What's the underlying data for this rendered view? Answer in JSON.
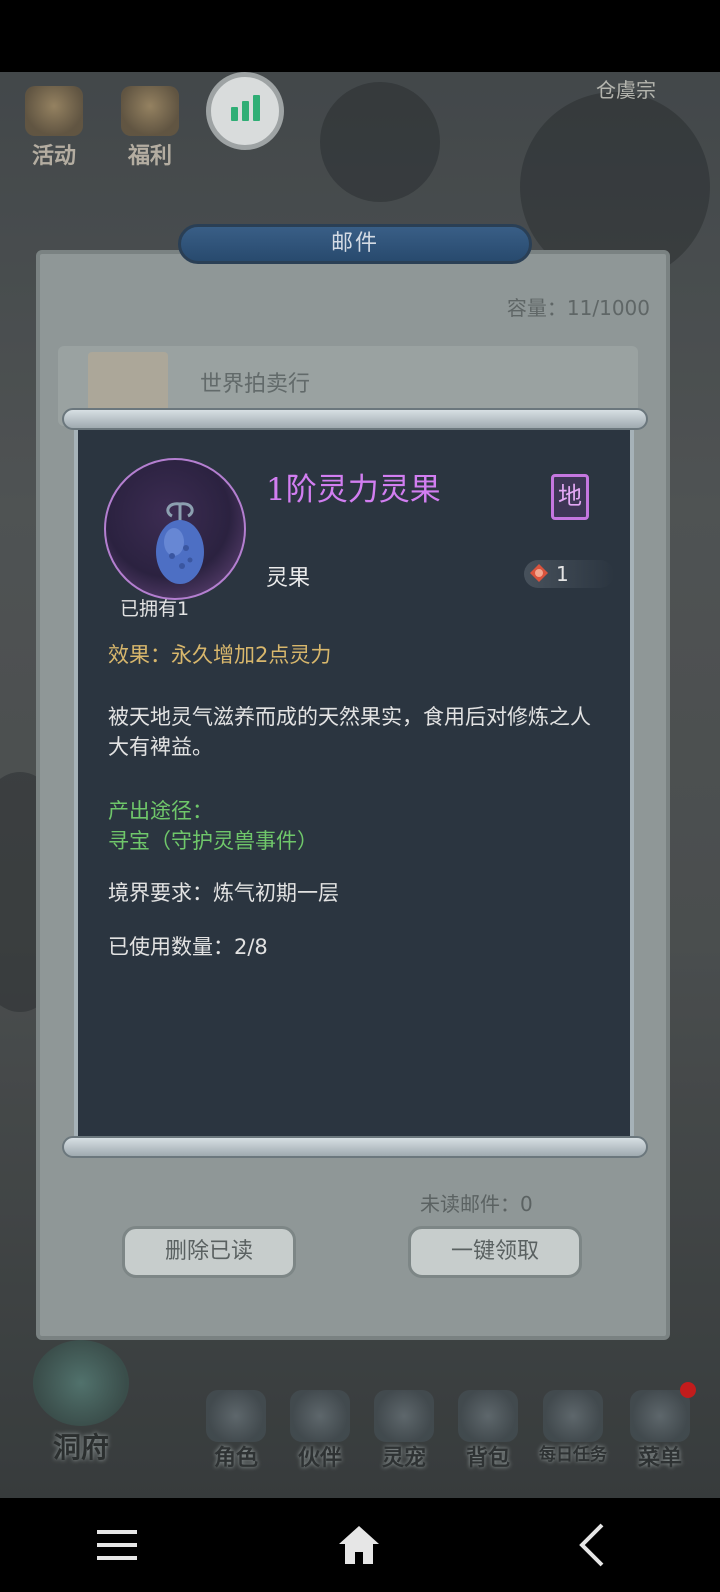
{
  "game": {
    "top_icons": [
      {
        "label": "活动",
        "icon": "event-icon"
      },
      {
        "label": "福利",
        "icon": "gift-icon"
      }
    ],
    "sect_name": "仓虞宗",
    "signal_icon": "signal-bars-icon"
  },
  "mail": {
    "title": "邮件",
    "capacity": "容量：11/1000",
    "entry_title": "世界拍卖行",
    "unread": "未读邮件：0",
    "delete_read_label": "删除已读",
    "claim_all_label": "一键领取"
  },
  "item": {
    "name": "1阶灵力灵果",
    "rank_seal": "地",
    "type": "灵果",
    "quantity": "1",
    "owned": "已拥有1",
    "effect": "效果：永久增加2点灵力",
    "description": "被天地灵气滋养而成的天然果实，食用后对修炼之人大有裨益。",
    "source_label": "产出途径：",
    "source_value": "寻宝（守护灵兽事件）",
    "requirement": "境界要求：炼气初期一层",
    "used_count": "已使用数量：2/8",
    "colors": {
      "name": "#d27ef1",
      "effect": "#d8b76c",
      "source": "#6fc76a"
    }
  },
  "game_nav": {
    "cave": "洞府",
    "items": [
      {
        "label": "角色",
        "icon": "character-icon"
      },
      {
        "label": "伙伴",
        "icon": "companion-icon"
      },
      {
        "label": "灵宠",
        "icon": "pet-icon"
      },
      {
        "label": "背包",
        "icon": "bag-icon"
      },
      {
        "label": "每日任务",
        "icon": "daily-task-icon"
      },
      {
        "label": "菜单",
        "icon": "menu-icon"
      }
    ]
  },
  "system_nav": {
    "buttons": [
      "menu-lines-icon",
      "home-icon",
      "back-icon"
    ]
  }
}
